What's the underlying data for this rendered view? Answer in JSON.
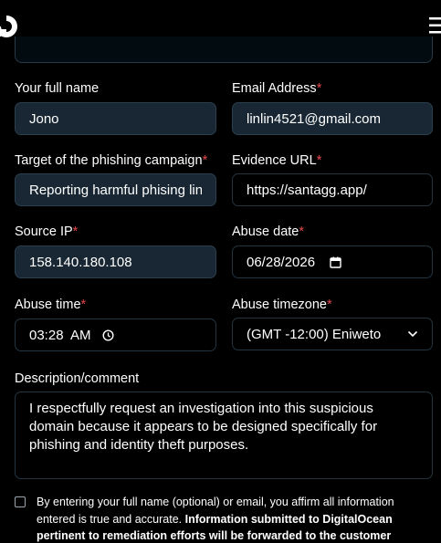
{
  "form": {
    "full_name": {
      "label": "Your full name",
      "value": "Jono"
    },
    "email": {
      "label": "Email Address",
      "required_mark": "*",
      "value": "linlin4521@gmail.com"
    },
    "target": {
      "label": "Target of the phishing campaign",
      "required_mark": "*",
      "value": "Reporting harmful phising lin"
    },
    "evidence_url": {
      "label": "Evidence URL",
      "required_mark": "*",
      "value": "https://santagg.app/"
    },
    "source_ip": {
      "label": "Source IP",
      "required_mark": "*",
      "value": "158.140.180.108"
    },
    "abuse_date": {
      "label": "Abuse date",
      "required_mark": "*",
      "value": "06/28/2026"
    },
    "abuse_time": {
      "label": "Abuse time",
      "required_mark": "*",
      "value": "03:28  AM"
    },
    "abuse_timezone": {
      "label": "Abuse timezone",
      "required_mark": "*",
      "value": "(GMT -12:00) Eniweto"
    },
    "description": {
      "label": "Description/comment",
      "lines": [
        "I respectfully request an investigation into this suspicious",
        "domain because it appears to be designed specifically for",
        "phishing and identity theft purposes."
      ]
    },
    "consent": {
      "text_plain": "By entering your full name (optional) or email, you affirm all information entered is true and accurate. ",
      "text_bold": "Information submitted to DigitalOcean pertinent to remediation efforts will be forwarded to the customer"
    }
  },
  "colors": {
    "background": "#000000",
    "field_filled": "#182733",
    "border": "#233541",
    "required": "#e5484d"
  },
  "icons": [
    "digitalocean-logo-icon",
    "hamburger-menu-icon",
    "calendar-icon",
    "clock-icon",
    "chevron-down-icon"
  ]
}
